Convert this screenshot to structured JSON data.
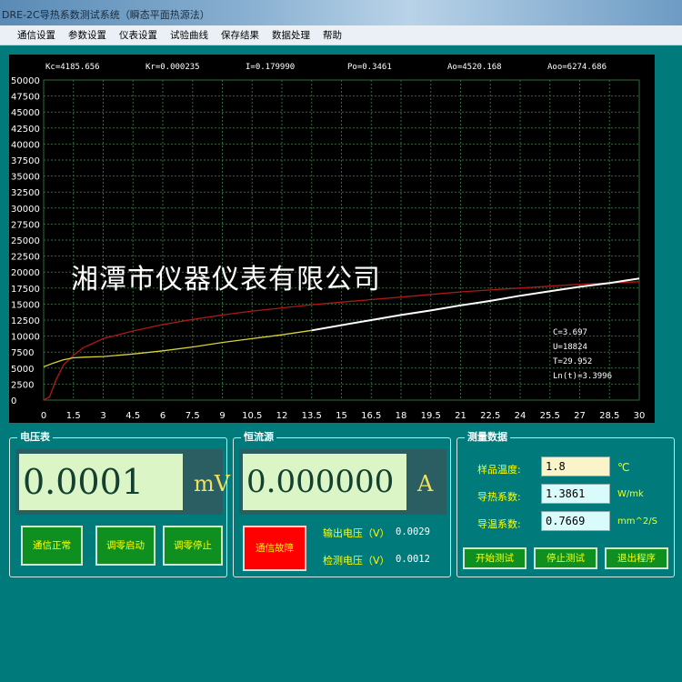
{
  "window": {
    "title": "DRE-2C导热系数测试系统（瞬态平面热源法）"
  },
  "menu": [
    "通信设置",
    "参数设置",
    "仪表设置",
    "试验曲线",
    "保存结果",
    "数据处理",
    "帮助"
  ],
  "chart_header": [
    "Kc=4185.656",
    "Kr=0.000235",
    "I=0.179990",
    "Po=0.3461",
    "Ao=4520.168",
    "Aoo=6274.686"
  ],
  "chart_annotations": [
    "C=3.697",
    "U=18824",
    "T=29.952",
    "Ln(t)=3.3996"
  ],
  "watermark": "湘潭市仪器仪表有限公司",
  "colors": {
    "background": "#007a7a",
    "grid": "#2f6a3a",
    "series_red": "#b01818",
    "series_yellow": "#d6d238",
    "series_white": "#ffffff",
    "lcd_bg": "#dcf5c7",
    "btn_green": "#0f8f1f",
    "btn_red": "#ff0000"
  },
  "chart_data": {
    "type": "line",
    "xlim": [
      0,
      30
    ],
    "ylim": [
      0,
      50000
    ],
    "x_ticks": [
      "0",
      "1.5",
      "3",
      "4.5",
      "6",
      "7.5",
      "9",
      "10.5",
      "12",
      "13.5",
      "15",
      "16.5",
      "18",
      "19.5",
      "21",
      "22.5",
      "24",
      "25.5",
      "27",
      "28.5",
      "30"
    ],
    "y_ticks": [
      "50000",
      "47500",
      "45000",
      "42500",
      "40000",
      "37500",
      "35000",
      "32500",
      "30000",
      "27500",
      "25000",
      "22500",
      "20000",
      "17500",
      "15000",
      "12500",
      "10000",
      "7500",
      "5000",
      "2500",
      "0"
    ],
    "grid": true,
    "series": [
      {
        "color": "red",
        "x": [
          0,
          0.3,
          0.6,
          1,
          1.5,
          2,
          3,
          4.5,
          6,
          7.5,
          9,
          10.5,
          12,
          13.5,
          15,
          16.5,
          18,
          19.5,
          21,
          22.5,
          24,
          25.5,
          27,
          28.5,
          30
        ],
        "y": [
          0,
          500,
          3000,
          5500,
          7000,
          8200,
          9600,
          10800,
          11800,
          12600,
          13300,
          13900,
          14400,
          14900,
          15300,
          15700,
          16100,
          16500,
          16900,
          17200,
          17500,
          17800,
          18100,
          18300,
          18500
        ]
      },
      {
        "color": "yellow",
        "x": [
          0,
          0.5,
          1,
          1.5,
          2,
          3,
          4.5,
          6,
          7.5,
          9,
          10.5,
          12,
          13.5
        ],
        "y": [
          5200,
          5800,
          6300,
          6600,
          6700,
          6800,
          7200,
          7700,
          8300,
          9000,
          9600,
          10200,
          10900
        ]
      },
      {
        "color": "white",
        "x": [
          13.5,
          15,
          16.5,
          18,
          19.5,
          21,
          22.5,
          24,
          25.5,
          27,
          28.5,
          30
        ],
        "y": [
          10900,
          11700,
          12500,
          13300,
          14000,
          14800,
          15500,
          16300,
          17000,
          17700,
          18300,
          19000
        ]
      }
    ]
  },
  "voltmeter": {
    "title": "电压表",
    "value": "0.0001",
    "unit": "mV"
  },
  "current_source": {
    "title": "恒流源",
    "value": "0.000000",
    "unit": "A"
  },
  "buttons": {
    "comm_ok": "通信正常",
    "zero_start": "调零启动",
    "zero_stop": "调零停止",
    "comm_fault": "通信故障",
    "start_test": "开始测试",
    "stop_test": "停止测试",
    "exit": "退出程序"
  },
  "outputs": {
    "output_voltage_label": "输出电压（V）",
    "output_voltage_value": "0.0029",
    "detect_voltage_label": "检测电压（V）",
    "detect_voltage_value": "0.0012"
  },
  "measure": {
    "title": "测量数据",
    "rows": [
      {
        "label": "样品温度:",
        "value": "1.8",
        "unit": "℃",
        "bg": "#fbf4c8"
      },
      {
        "label": "导热系数:",
        "value": "1.3861",
        "unit": "W/mk",
        "bg": "#d9fbfb"
      },
      {
        "label": "导温系数:",
        "value": "0.7669",
        "unit": "mm^2/S",
        "bg": "#d9fbfb"
      }
    ]
  }
}
